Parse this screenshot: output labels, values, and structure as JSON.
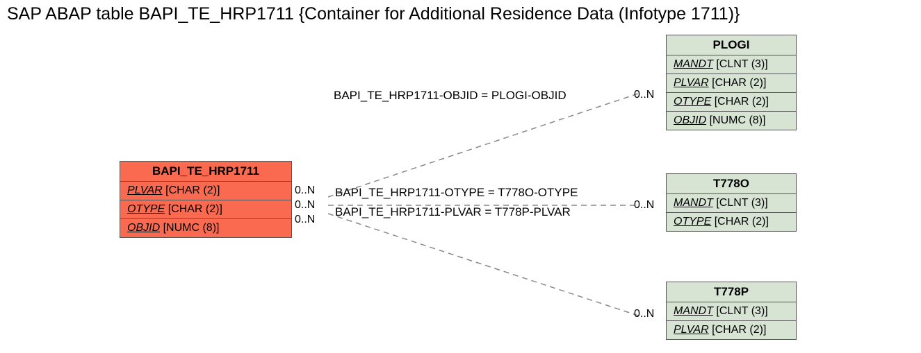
{
  "title": "SAP ABAP table BAPI_TE_HRP1711 {Container for Additional Residence Data (Infotype 1711)}",
  "main": {
    "name": "BAPI_TE_HRP1711",
    "fields": [
      {
        "n": "PLVAR",
        "t": "[CHAR (2)]"
      },
      {
        "n": "OTYPE",
        "t": "[CHAR (2)]"
      },
      {
        "n": "OBJID",
        "t": "[NUMC (8)]"
      }
    ],
    "card": [
      "0..N",
      "0..N",
      "0..N"
    ]
  },
  "rels": [
    {
      "text": "BAPI_TE_HRP1711-OBJID = PLOGI-OBJID",
      "card": "0..N"
    },
    {
      "text": "BAPI_TE_HRP1711-OTYPE = T778O-OTYPE",
      "card": "0..N"
    },
    {
      "text": "BAPI_TE_HRP1711-PLVAR = T778P-PLVAR",
      "card": "0..N"
    }
  ],
  "targets": [
    {
      "name": "PLOGI",
      "fields": [
        {
          "n": "MANDT",
          "t": "[CLNT (3)]"
        },
        {
          "n": "PLVAR",
          "t": "[CHAR (2)]"
        },
        {
          "n": "OTYPE",
          "t": "[CHAR (2)]"
        },
        {
          "n": "OBJID",
          "t": "[NUMC (8)]"
        }
      ]
    },
    {
      "name": "T778O",
      "fields": [
        {
          "n": "MANDT",
          "t": "[CLNT (3)]"
        },
        {
          "n": "OTYPE",
          "t": "[CHAR (2)]"
        }
      ]
    },
    {
      "name": "T778P",
      "fields": [
        {
          "n": "MANDT",
          "t": "[CLNT (3)]"
        },
        {
          "n": "PLVAR",
          "t": "[CHAR (2)]"
        }
      ]
    }
  ]
}
